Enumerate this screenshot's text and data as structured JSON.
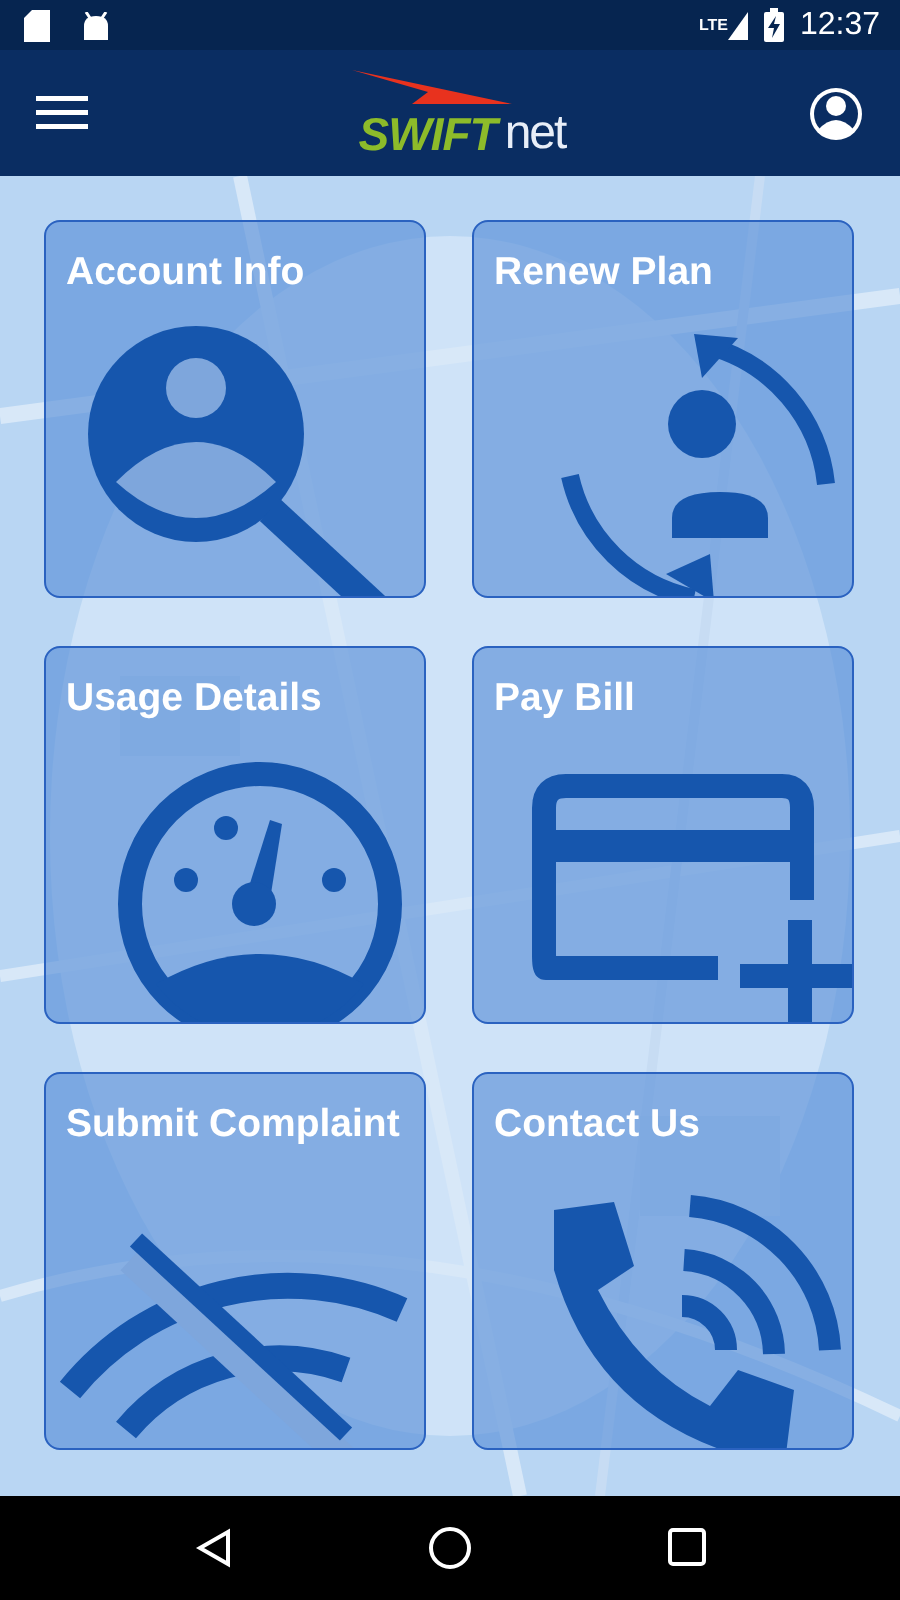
{
  "status_bar": {
    "network": "LTE",
    "time": "12:37"
  },
  "header": {
    "logo_primary": "SWIFT",
    "logo_secondary": "net"
  },
  "tiles": [
    {
      "title": "Account Info",
      "kind": "account"
    },
    {
      "title": "Renew Plan",
      "kind": "renew"
    },
    {
      "title": "Usage Details",
      "kind": "usage"
    },
    {
      "title": "Pay Bill",
      "kind": "bill"
    },
    {
      "title": "Submit Complaint",
      "kind": "complaint"
    },
    {
      "title": "Contact Us",
      "kind": "contact"
    }
  ]
}
